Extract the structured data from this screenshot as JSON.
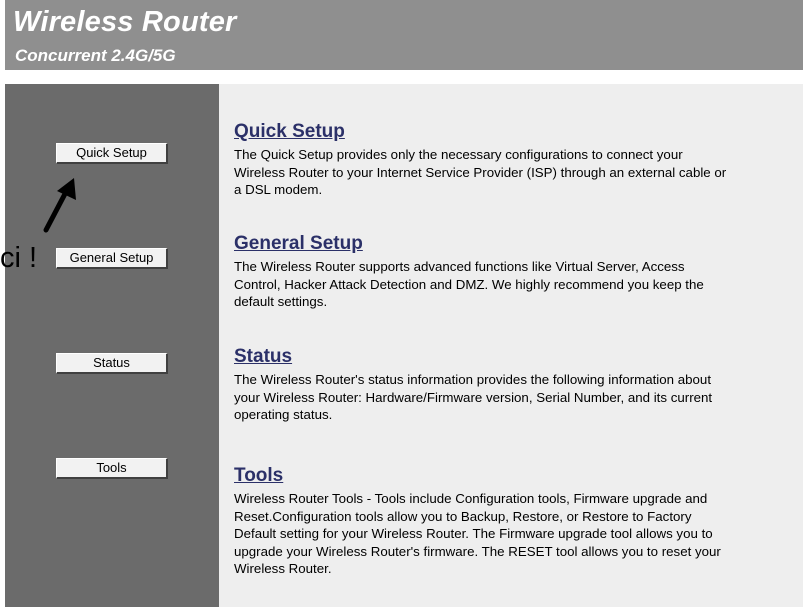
{
  "header": {
    "title": "Wireless Router",
    "subtitle": "Concurrent 2.4G/5G"
  },
  "nav": {
    "quick_setup": "Quick Setup",
    "general_setup": "General Setup",
    "status": "Status",
    "tools": "Tools"
  },
  "annotation": {
    "text": "ci !",
    "arrow_icon": "arrow-up-right-icon"
  },
  "sections": [
    {
      "title": "Quick Setup",
      "desc": "The Quick Setup provides only the necessary configurations to connect your Wireless Router to your Internet Service Provider (ISP) through an external cable or a DSL modem."
    },
    {
      "title": "General Setup",
      "desc": "The Wireless Router supports advanced functions like Virtual Server, Access Control, Hacker Attack Detection and DMZ. We highly recommend you keep the default settings."
    },
    {
      "title": "Status",
      "desc": "The Wireless Router's status information provides the following information about your Wireless Router: Hardware/Firmware version, Serial Number, and its current operating status."
    },
    {
      "title": "Tools",
      "desc": "Wireless Router Tools - Tools include Configuration tools, Firmware upgrade and Reset.Configuration tools allow you to Backup, Restore, or Restore to Factory Default setting for your Wireless Router. The Firmware upgrade tool allows you to upgrade your Wireless Router's firmware. The RESET tool allows you to reset your Wireless Router."
    }
  ],
  "colors": {
    "header_bg": "#8f8f8f",
    "sidebar_bg": "#6b6b6b",
    "main_bg": "#eeeeee",
    "link": "#2b3068"
  }
}
